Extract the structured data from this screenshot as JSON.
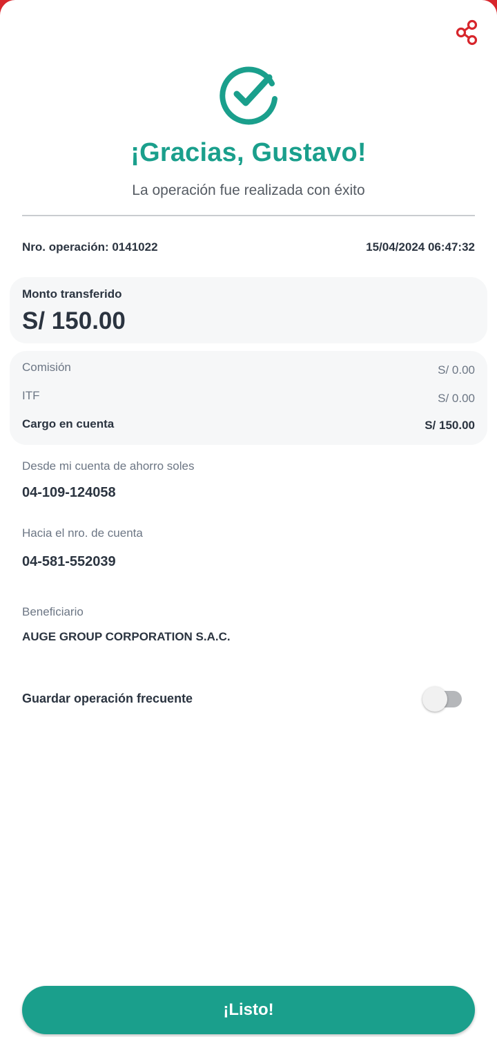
{
  "colors": {
    "accent": "#1a9f8c",
    "share_icon": "#d7262c",
    "text_dark": "#2b3440",
    "text_muted": "#6c7684"
  },
  "header": {
    "share_icon": "share-icon",
    "success_icon": "check-circle-icon",
    "title": "¡Gracias, Gustavo!",
    "subtitle": "La operación fue realizada con éxito"
  },
  "operation": {
    "number": "Nro. operación: 0141022",
    "datetime": "15/04/2024 06:47:32"
  },
  "amount": {
    "label": "Monto transferido",
    "value": "S/ 150.00"
  },
  "fees": [
    {
      "label": "Comisión",
      "value": "S/ 0.00"
    },
    {
      "label": "ITF",
      "value": "S/ 0.00"
    },
    {
      "label": "Cargo en cuenta",
      "value": "S/ 150.00"
    }
  ],
  "source": {
    "label": "Desde mi cuenta de ahorro soles",
    "value": "04-109-124058"
  },
  "destination": {
    "label": "Hacia el nro. de cuenta",
    "value": "04-581-552039"
  },
  "beneficiary": {
    "label": "Beneficiario",
    "value": "AUGE GROUP CORPORATION S.A.C."
  },
  "frequent": {
    "label": "Guardar operación frecuente",
    "enabled": false
  },
  "actions": {
    "done_label": "¡Listo!"
  }
}
